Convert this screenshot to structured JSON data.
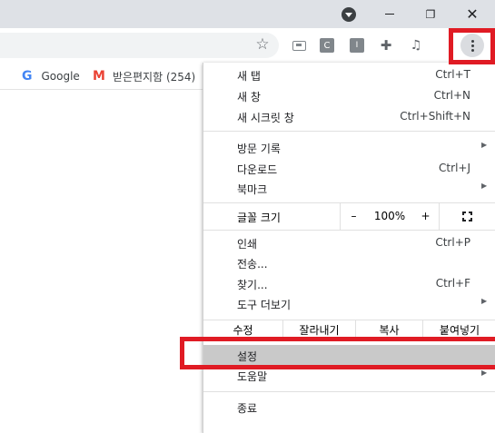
{
  "window": {
    "minimize_glyph": "—",
    "restore_glyph": "❐",
    "close_glyph": "✕"
  },
  "toolbar": {
    "bookmark_star_glyph": "☆",
    "ext_c_label": "C",
    "ext_i_label": "I",
    "puzzle_glyph": "✚",
    "media_glyph": "♫"
  },
  "bookmarks": [
    {
      "icon": "google-icon",
      "icon_text": "G",
      "label": "Google"
    },
    {
      "icon": "gmail-icon",
      "icon_text": "M",
      "label": "받은편지함 (254)"
    }
  ],
  "menu": {
    "group1": [
      {
        "label": "새 탭",
        "shortcut": "Ctrl+T"
      },
      {
        "label": "새 창",
        "shortcut": "Ctrl+N"
      },
      {
        "label": "새 시크릿 창",
        "shortcut": "Ctrl+Shift+N"
      }
    ],
    "group2": [
      {
        "label": "방문 기록",
        "arrow": "▶"
      },
      {
        "label": "다운로드",
        "shortcut": "Ctrl+J"
      },
      {
        "label": "북마크",
        "arrow": "▶"
      }
    ],
    "zoom": {
      "label": "글꼴 크기",
      "minus": "–",
      "value": "100%",
      "plus": "+"
    },
    "group3": [
      {
        "label": "인쇄",
        "shortcut": "Ctrl+P"
      },
      {
        "label": "전송..."
      },
      {
        "label": "찾기...",
        "shortcut": "Ctrl+F"
      },
      {
        "label": "도구 더보기",
        "arrow": "▶"
      }
    ],
    "edit": {
      "label": "수정",
      "cut": "잘라내기",
      "copy": "복사",
      "paste": "붙여넣기"
    },
    "settings": {
      "label": "설정"
    },
    "help": {
      "label": "도움말",
      "arrow": "▶"
    },
    "exit": {
      "label": "종료"
    }
  },
  "colors": {
    "annotation_red": "#e01b24",
    "highlight_gray": "#c9c9c9",
    "titlebar": "#dee1e6"
  }
}
